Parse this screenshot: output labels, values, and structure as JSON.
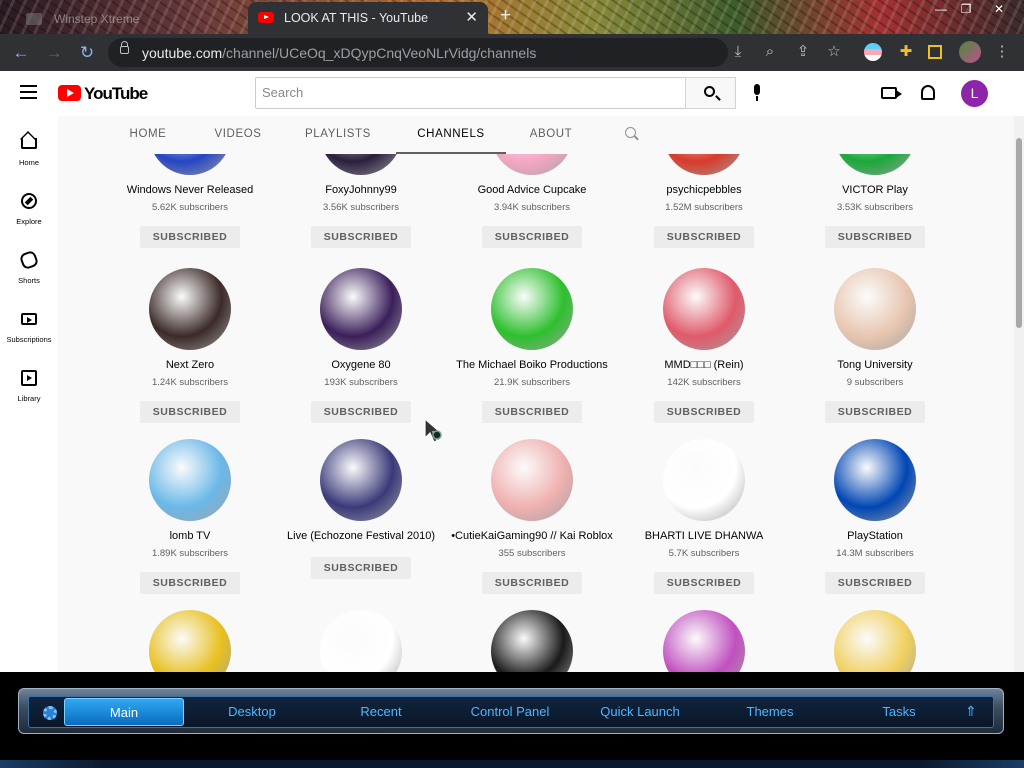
{
  "browser": {
    "inactive_tab": "Winstep Xtreme",
    "active_tab": "LOOK AT THIS - YouTube",
    "tab_close": "✕",
    "new_tab": "+",
    "url_domain": "youtube.com",
    "url_path": "/channel/UCeOq_xDQypCnqVeoNLrVidg/channels"
  },
  "youtube": {
    "logo_text": "YouTube",
    "search_placeholder": "Search",
    "avatar_letter": "L",
    "nav": [
      {
        "label": "Home",
        "icon": "home-icon"
      },
      {
        "label": "Explore",
        "icon": "explore-icon"
      },
      {
        "label": "Shorts",
        "icon": "shorts-icon"
      },
      {
        "label": "Subscriptions",
        "icon": "subscriptions-icon"
      },
      {
        "label": "Library",
        "icon": "library-icon"
      }
    ],
    "channel_tabs": [
      "HOME",
      "VIDEOS",
      "PLAYLISTS",
      "CHANNELS",
      "ABOUT"
    ],
    "active_channel_tab": "CHANNELS",
    "button_label": "SUBSCRIBED",
    "channels": [
      {
        "name": "Windows Never Released",
        "subs": "5.62K subscribers",
        "color": "#2546c4"
      },
      {
        "name": "FoxyJohnny99",
        "subs": "3.56K subscribers",
        "color": "#2a1f3d"
      },
      {
        "name": "Good Advice Cupcake",
        "subs": "3.94K subscribers",
        "color": "#f5a6c4"
      },
      {
        "name": "psychicpebbles",
        "subs": "1.52M subscribers",
        "color": "#d83a2a"
      },
      {
        "name": "VICTOR Play",
        "subs": "3.53K subscribers",
        "color": "#1aa83a"
      },
      {
        "name": "Next Zero",
        "subs": "1.24K subscribers",
        "color": "#3b2a28"
      },
      {
        "name": "Oxygene 80",
        "subs": "193K subscribers",
        "color": "#3a1f5a"
      },
      {
        "name": "The Michael Boiko Productions",
        "subs": "21.9K subscribers",
        "color": "#2dc02d"
      },
      {
        "name": "MMD□□□ (Rein)",
        "subs": "142K subscribers",
        "color": "#e05a6a"
      },
      {
        "name": "Tong University",
        "subs": "9 subscribers",
        "color": "#e8c6b0"
      },
      {
        "name": "lomb TV",
        "subs": "1.89K subscribers",
        "color": "#6ab8e8"
      },
      {
        "name": "Live (Echozone Festival 2010)",
        "subs": "",
        "color": "#3a3a7a"
      },
      {
        "name": "•CutieKaiGaming90 // Kai Roblox",
        "subs": "355 subscribers",
        "color": "#f0b0b0"
      },
      {
        "name": "BHARTI LIVE DHANWA",
        "subs": "5.7K subscribers",
        "color": "#ffffff"
      },
      {
        "name": "PlayStation",
        "subs": "14.3M subscribers",
        "color": "#0046b4"
      },
      {
        "name": "",
        "subs": "",
        "color": "#e8c020"
      },
      {
        "name": "",
        "subs": "",
        "color": "#ffffff"
      },
      {
        "name": "",
        "subs": "",
        "color": "#1a1a1a"
      },
      {
        "name": "",
        "subs": "",
        "color": "#c050c0"
      },
      {
        "name": "",
        "subs": "",
        "color": "#f0d060"
      }
    ]
  },
  "taskbar": {
    "items": [
      "Main",
      "Desktop",
      "Recent",
      "Control Panel",
      "Quick Launch",
      "Themes",
      "Tasks"
    ],
    "active": "Main"
  }
}
